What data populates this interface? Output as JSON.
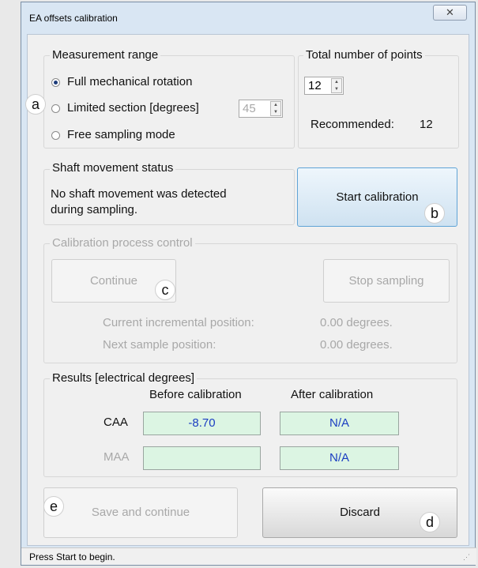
{
  "window": {
    "title": "EA offsets calibration",
    "close_icon": "✕"
  },
  "measurement_range": {
    "title": "Measurement range",
    "options": [
      {
        "label": "Full mechanical rotation",
        "selected": true
      },
      {
        "label": "Limited section [degrees]",
        "selected": false
      },
      {
        "label": "Free sampling mode",
        "selected": false
      }
    ],
    "limited_value": "45"
  },
  "points": {
    "title": "Total number of points",
    "value": "12",
    "recommended_label": "Recommended:",
    "recommended_value": "12"
  },
  "shaft": {
    "title": "Shaft movement status",
    "message_line1": "No shaft movement was detected",
    "message_line2": "during sampling."
  },
  "start_button": "Start calibration",
  "process": {
    "title": "Calibration process control",
    "continue_button": "Continue",
    "stop_button": "Stop sampling",
    "current_label": "Current incremental position:",
    "current_value": "0.00 degrees.",
    "next_label": "Next sample position:",
    "next_value": "0.00 degrees."
  },
  "results": {
    "title": "Results [electrical degrees]",
    "col_before": "Before calibration",
    "col_after": "After calibration",
    "rows": [
      {
        "label": "CAA",
        "before": "-8.70",
        "after": "N/A"
      },
      {
        "label": "MAA",
        "before": "",
        "after": "N/A"
      }
    ]
  },
  "save_button": "Save and continue",
  "discard_button": "Discard",
  "status": "Press Start to begin.",
  "callouts": {
    "a": "a",
    "b": "b",
    "c": "c",
    "d": "d",
    "e": "e"
  }
}
